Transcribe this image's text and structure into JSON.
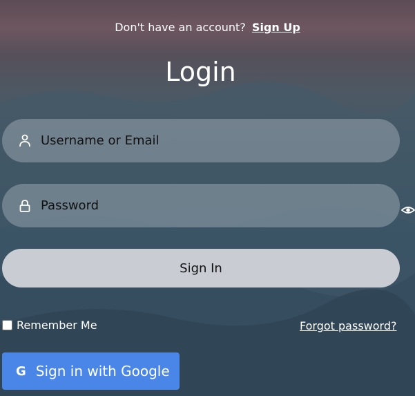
{
  "header": {
    "prompt": "Don't have an account?",
    "signup_link": "Sign Up",
    "title": "Login"
  },
  "form": {
    "username_placeholder": "Username or Email",
    "password_placeholder": "Password",
    "signin_label": "Sign In",
    "remember_label": "Remember Me",
    "forgot_label": "Forgot password?",
    "google_label": "Sign in with Google",
    "google_glyph": "G"
  },
  "icons": {
    "username": "user-icon",
    "password": "lock-icon",
    "toggle": "eye-icon"
  },
  "colors": {
    "google": "#4a86e8",
    "signin": "#c9cdd3",
    "field": "rgba(190,196,204,0.38)"
  }
}
